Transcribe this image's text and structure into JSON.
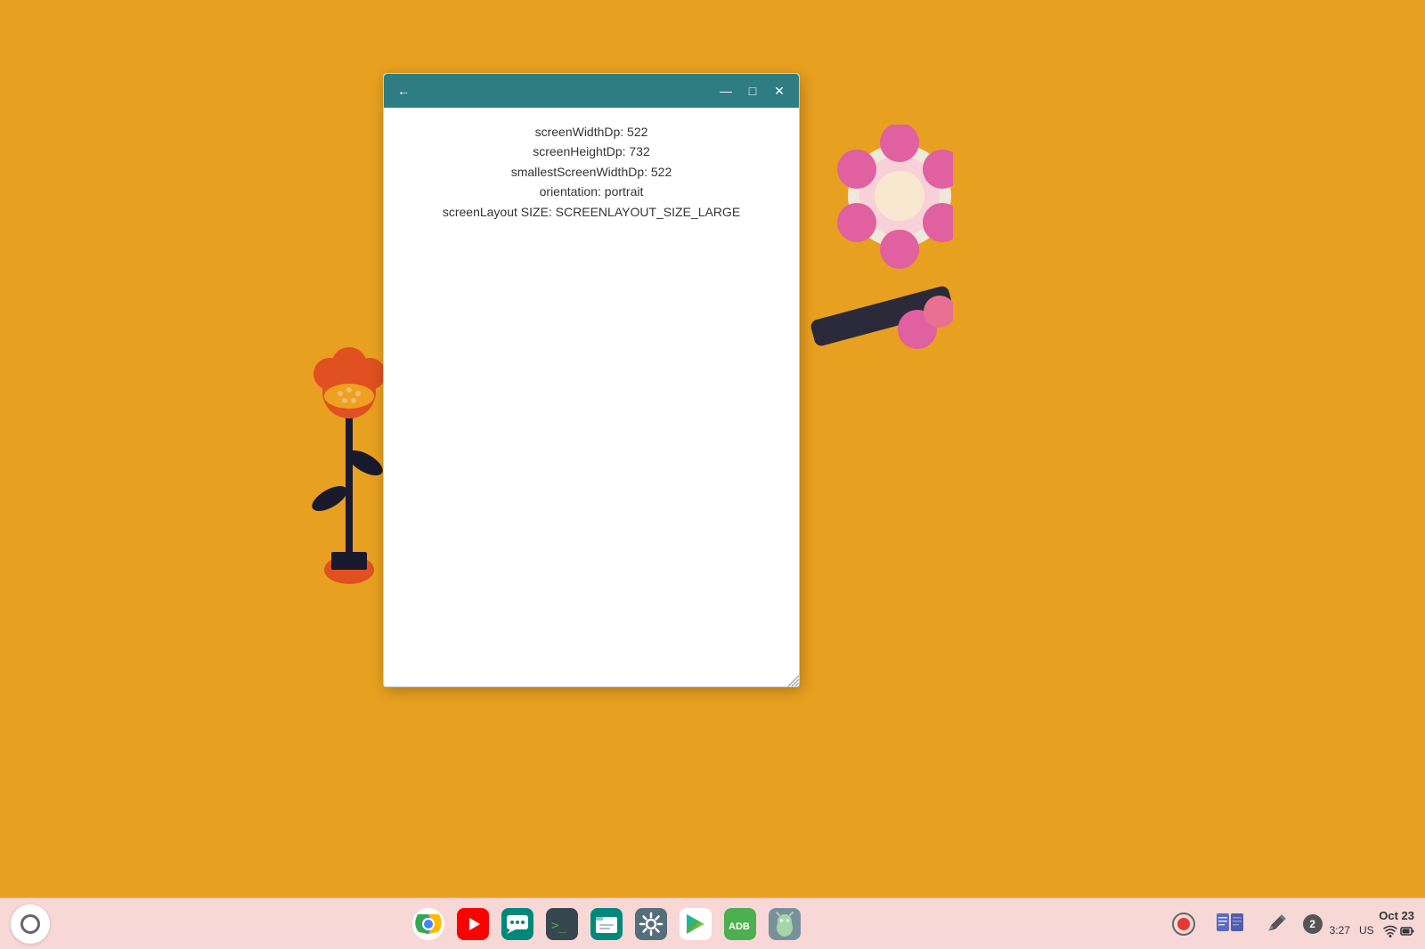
{
  "desktop": {
    "background_color": "#E8A020"
  },
  "window": {
    "title": "",
    "title_bar_color": "#2E7D82",
    "back_button": "←",
    "minimize_button": "—",
    "maximize_button": "□",
    "close_button": "✕",
    "content": {
      "lines": [
        "screenWidthDp: 522",
        "screenHeightDp: 732",
        "smallestScreenWidthDp: 522",
        "orientation: portrait",
        "screenLayout SIZE: SCREENLAYOUT_SIZE_LARGE"
      ]
    }
  },
  "taskbar": {
    "launcher_label": "launcher",
    "apps": [
      {
        "name": "Chrome",
        "icon": "chrome"
      },
      {
        "name": "YouTube",
        "icon": "youtube"
      },
      {
        "name": "Messages",
        "icon": "messages"
      },
      {
        "name": "Terminal",
        "icon": "terminal"
      },
      {
        "name": "Files",
        "icon": "files"
      },
      {
        "name": "Settings",
        "icon": "settings"
      },
      {
        "name": "Play Store",
        "icon": "play"
      },
      {
        "name": "ADB",
        "icon": "adb"
      },
      {
        "name": "Android",
        "icon": "android"
      }
    ],
    "tray": {
      "record": "●",
      "reader": "📖",
      "pen": "✏",
      "notification_count": "2"
    },
    "datetime": {
      "date": "Oct 23",
      "time": "3:27",
      "locale": "US"
    },
    "wifi": "wifi",
    "battery": "battery"
  }
}
